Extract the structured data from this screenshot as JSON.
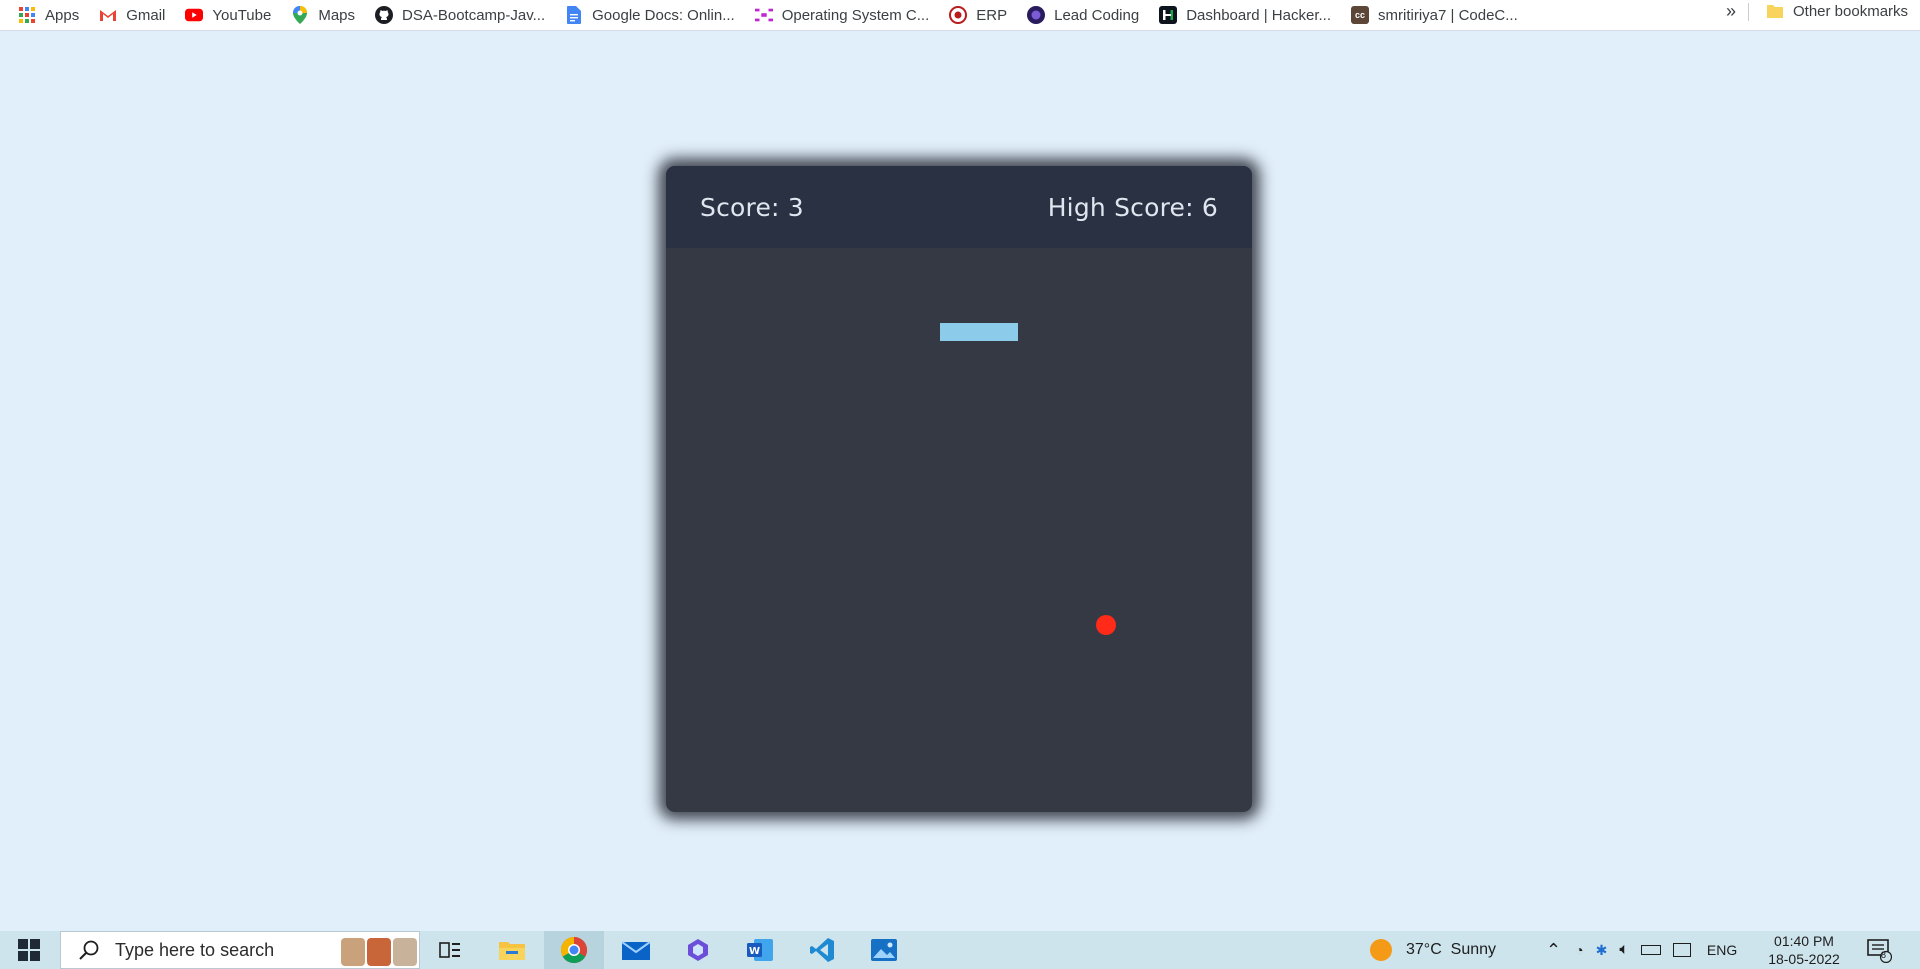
{
  "bookmarks": {
    "items": [
      {
        "label": "Apps",
        "icon": "apps-grid-icon"
      },
      {
        "label": "Gmail",
        "icon": "gmail-icon"
      },
      {
        "label": "YouTube",
        "icon": "youtube-icon"
      },
      {
        "label": "Maps",
        "icon": "maps-icon"
      },
      {
        "label": "DSA-Bootcamp-Jav...",
        "icon": "github-icon"
      },
      {
        "label": "Google Docs: Onlin...",
        "icon": "google-docs-icon"
      },
      {
        "label": "Operating System C...",
        "icon": "os-course-icon"
      },
      {
        "label": "ERP",
        "icon": "erp-icon"
      },
      {
        "label": "Lead Coding",
        "icon": "lead-coding-icon"
      },
      {
        "label": "Dashboard | Hacker...",
        "icon": "hackerrank-icon"
      },
      {
        "label": "smritiriya7 | CodeC...",
        "icon": "codechef-icon"
      }
    ],
    "overflow": "»",
    "other_label": "Other bookmarks"
  },
  "game": {
    "score_text": "Score: 3",
    "high_score_text": "High Score: 6"
  },
  "taskbar": {
    "search_placeholder": "Type here to search",
    "weather": "37°C  Sunny",
    "language": "ENG",
    "time": "01:40 PM",
    "date": "18-05-2022",
    "notification_count": "8"
  },
  "colors": {
    "page_bg": "#e1effa",
    "board_bg": "#343944",
    "details_bg": "#293142",
    "snake": "#8ccbea",
    "food": "#ff2a17"
  }
}
